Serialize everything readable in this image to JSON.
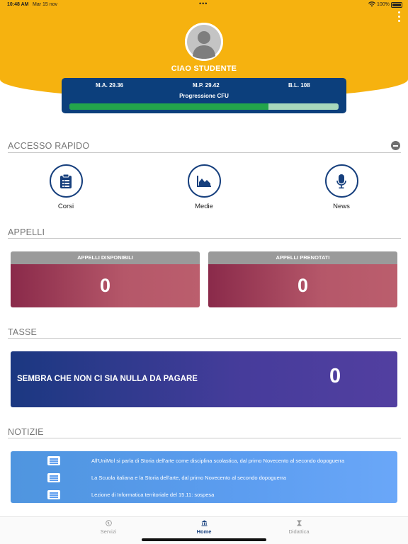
{
  "status_bar": {
    "time": "10:48 AM",
    "date": "Mar 15 nov",
    "dots": "•••",
    "battery": "100%"
  },
  "header": {
    "greeting": "CIAO STUDENTE",
    "stats": {
      "ma": "M.A. 29.36",
      "mp": "M.P. 29.42",
      "bl": "B.L. 108"
    },
    "progress_label": "Progressione CFU",
    "progress_fraction": 0.74
  },
  "quick_access": {
    "title": "ACCESSO RAPIDO",
    "items": [
      {
        "label": "Corsi",
        "icon": "clipboard-icon"
      },
      {
        "label": "Medie",
        "icon": "area-chart-icon"
      },
      {
        "label": "News",
        "icon": "microphone-icon"
      }
    ]
  },
  "appelli": {
    "title": "APPELLI",
    "cards": [
      {
        "header": "APPELLI DISPONIBILI",
        "value": "0"
      },
      {
        "header": "APPELLI PRENOTATI",
        "value": "0"
      }
    ]
  },
  "tasse": {
    "title": "TASSE",
    "message": "SEMBRA CHE NON CI SIA NULLA DA PAGARE",
    "value": "0"
  },
  "notizie": {
    "title": "NOTIZIE",
    "items": [
      {
        "text": "All'UniMol si parla di Storia dell'arte come disciplina scolastica, dal primo Novecento al secondo dopoguerra"
      },
      {
        "text": "La Scuola italiana e la Storia dell'arte, dal primo Novecento al secondo dopoguerra"
      },
      {
        "text": "Lezione di Informatica territoriale del 15.11: sospesa"
      }
    ]
  },
  "tabs": [
    {
      "label": "Servizi",
      "icon": "globe-icon",
      "active": false
    },
    {
      "label": "Home",
      "icon": "bank-icon",
      "active": true
    },
    {
      "label": "Didattica",
      "icon": "hourglass-icon",
      "active": false
    }
  ],
  "colors": {
    "header": "#f6b20f",
    "navy": "#0c3f7c",
    "progress": "#23a54b",
    "appelli_gradient": "#8a2a4a",
    "tasse_gradient": "#1b3881",
    "news_gradient": "#5c9df0"
  }
}
